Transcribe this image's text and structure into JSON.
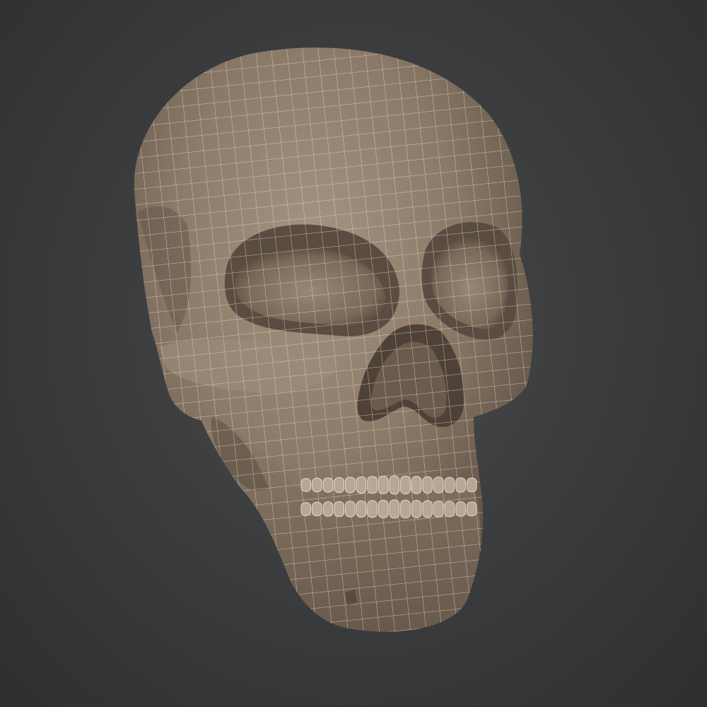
{
  "scene": {
    "subject": "skull-wireframe-model",
    "colors": {
      "background_center": "#4a4c4e",
      "background_edge": "#2d2f31",
      "bone": "#8c7a68",
      "bone_shadow": "#5e5044",
      "bone_highlight": "#a69584",
      "wire": "#e6ddd2",
      "teeth": "#b8a795"
    }
  }
}
